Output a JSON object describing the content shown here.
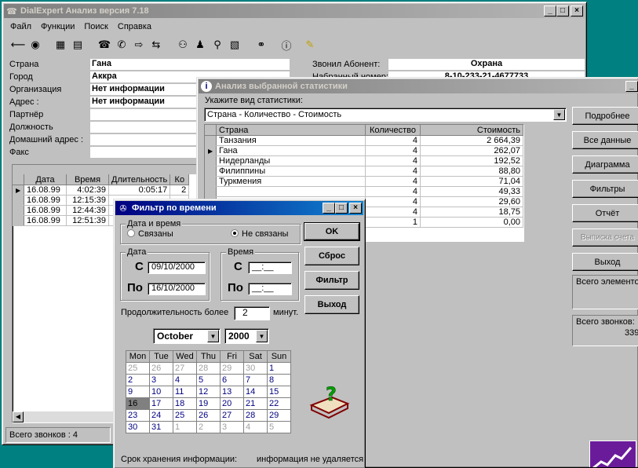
{
  "main": {
    "title": "DialExpert Анализ версия 7.18",
    "menu": [
      "Файл",
      "Функции",
      "Поиск",
      "Справка"
    ],
    "fields": [
      {
        "label": "Страна",
        "value": "Гана"
      },
      {
        "label": "Город",
        "value": "Аккра"
      },
      {
        "label": "Организация",
        "value": "Нет информации"
      },
      {
        "label": "Адрес :",
        "value": "Нет информации"
      },
      {
        "label": "Партнёр",
        "value": ""
      },
      {
        "label": "Должность",
        "value": ""
      },
      {
        "label": "Домашний адрес :",
        "value": ""
      },
      {
        "label": "Факс",
        "value": ""
      }
    ],
    "caller_label": "Звонил Абонент:",
    "caller_value": "Охрана",
    "dialed_label": "Набранный номер:",
    "dialed_value": "8-10-233-21-4677733",
    "calls_table": {
      "headers": [
        "Дата",
        "Время",
        "Длительность",
        "Ко"
      ],
      "rows": [
        [
          "16.08.99",
          "4:02:39",
          "0:05:17",
          "2"
        ],
        [
          "16.08.99",
          "12:15:39",
          "",
          ""
        ],
        [
          "16.08.99",
          "12:44:39",
          "",
          ""
        ],
        [
          "16.08.99",
          "12:51:39",
          "",
          ""
        ]
      ]
    },
    "status": "Всего звонков : 4"
  },
  "stats": {
    "title": "Анализ выбранной статистики",
    "type_label": "Укажите вид статистики:",
    "type_value": "Страна - Количество - Стоимость",
    "headers": [
      "Страна",
      "Количество",
      "Стоимость"
    ],
    "rows": [
      [
        "Танзания",
        "4",
        "2 664,39"
      ],
      [
        "Гана",
        "4",
        "262,07"
      ],
      [
        "Нидерланды",
        "4",
        "192,52"
      ],
      [
        "Филиппины",
        "4",
        "88,80"
      ],
      [
        "Туркмения",
        "4",
        "71,04"
      ],
      [
        "",
        "4",
        "49,33"
      ],
      [
        "",
        "4",
        "29,60"
      ],
      [
        "",
        "4",
        "18,75"
      ],
      [
        "",
        "1",
        "0,00"
      ]
    ],
    "buttons": [
      "Подробнее",
      "Все данные",
      "Диаграмма",
      "Фильтры",
      "Отчёт",
      "Выписка счета",
      "Выход"
    ],
    "total_elements_label": "Всего элементо",
    "total_calls_label": "Всего звонков:",
    "total_calls_value": "339"
  },
  "filter": {
    "title": "Фильтр по времени",
    "datetime_group": "Дата и время",
    "radio_linked": "Связаны",
    "radio_unlinked": "Не связаны",
    "date_group": "Дата",
    "time_group": "Время",
    "from_label": "С",
    "to_label": "По",
    "date_from": "09/10/2000",
    "date_to": "16/10/2000",
    "time_from": "__:__",
    "time_to": "__:__",
    "duration_label": "Продолжительность более",
    "duration_value": "2",
    "minutes_label": "минут.",
    "month": "October",
    "year": "2000",
    "weekdays": [
      "Mon",
      "Tue",
      "Wed",
      "Thu",
      "Fri",
      "Sat",
      "Sun"
    ],
    "weeks": [
      [
        "25",
        "26",
        "27",
        "28",
        "29",
        "30",
        "1"
      ],
      [
        "2",
        "3",
        "4",
        "5",
        "6",
        "7",
        "8"
      ],
      [
        "9",
        "10",
        "11",
        "12",
        "13",
        "14",
        "15"
      ],
      [
        "16",
        "17",
        "18",
        "19",
        "20",
        "21",
        "22"
      ],
      [
        "23",
        "24",
        "25",
        "26",
        "27",
        "28",
        "29"
      ],
      [
        "30",
        "31",
        "1",
        "2",
        "3",
        "4",
        "5"
      ]
    ],
    "buttons": {
      "ok": "OK",
      "reset": "Сброс",
      "filter": "Фильтр",
      "exit": "Выход"
    },
    "storage_label": "Срок хранения информации:",
    "storage_value": "информация не удаляется"
  }
}
